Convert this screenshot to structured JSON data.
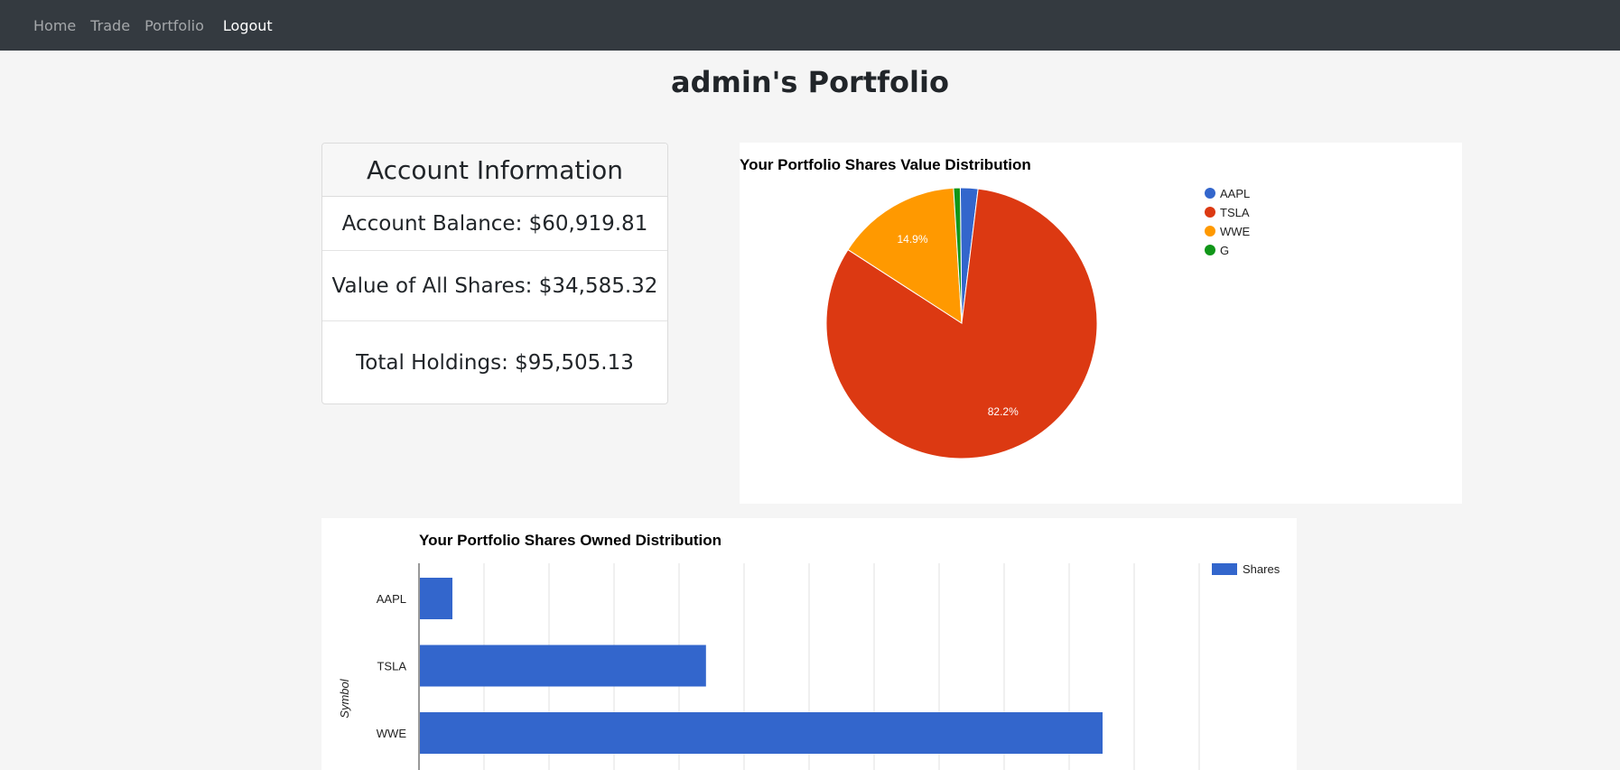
{
  "nav": {
    "items": [
      "Home",
      "Trade",
      "Portfolio"
    ],
    "logout": "Logout"
  },
  "page_title": "admin's Portfolio",
  "account": {
    "header": "Account Information",
    "balance": "Account Balance: $60,919.81",
    "shares_value": "Value of All Shares: $34,585.32",
    "total": "Total Holdings: $95,505.13"
  },
  "chart_data": [
    {
      "type": "pie",
      "title": "Your Portfolio Shares Value Distribution",
      "labels": [
        "AAPL",
        "TSLA",
        "WWE",
        "G"
      ],
      "values": [
        2.1,
        82.2,
        14.9,
        0.8
      ],
      "slice_labels": [
        "",
        "82.2%",
        "14.9%",
        ""
      ],
      "colors": [
        "#3366cc",
        "#dc3912",
        "#ff9900",
        "#109618"
      ],
      "legend": "right"
    },
    {
      "type": "bar",
      "orientation": "horizontal",
      "title": "Your Portfolio Shares Owned Distribution",
      "categories": [
        "AAPL",
        "TSLA",
        "WWE"
      ],
      "series": [
        {
          "name": "Shares",
          "values": [
            5,
            44,
            105
          ],
          "color": "#3366cc"
        }
      ],
      "ylabel": "Symbol",
      "xlim": [
        0,
        120
      ],
      "grid": true,
      "legend": "top-right"
    }
  ]
}
